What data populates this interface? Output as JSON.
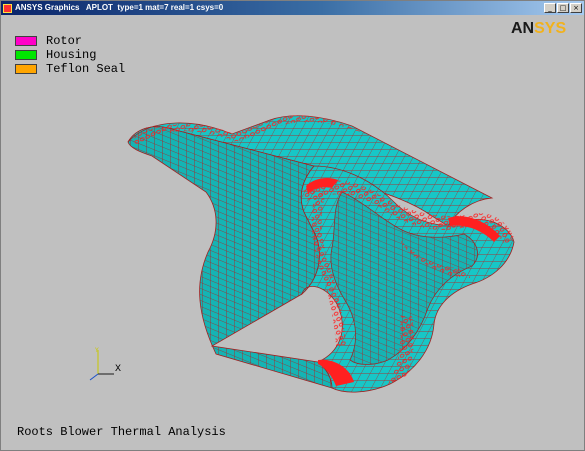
{
  "window": {
    "title": "ANSYS Graphics   APLOT  type=1 mat=7 real=1 csys=0",
    "controls": {
      "minimize": "_",
      "maximize": "□",
      "close": "×"
    }
  },
  "logo": {
    "part1": "AN",
    "part2": "SYS"
  },
  "legend": {
    "items": [
      {
        "label": "Rotor",
        "color": "#ff00c8"
      },
      {
        "label": "Housing",
        "color": "#00e600"
      },
      {
        "label": "Teflon Seal",
        "color": "#ffa500"
      }
    ]
  },
  "triad": {
    "x_label": "X"
  },
  "caption": "Roots Blower Thermal Analysis",
  "colors": {
    "background": "#c0c0c0",
    "mesh_fill": "#17c7c7",
    "mesh_lines": "#c01818",
    "boundary_symbols": "#ff2020"
  }
}
